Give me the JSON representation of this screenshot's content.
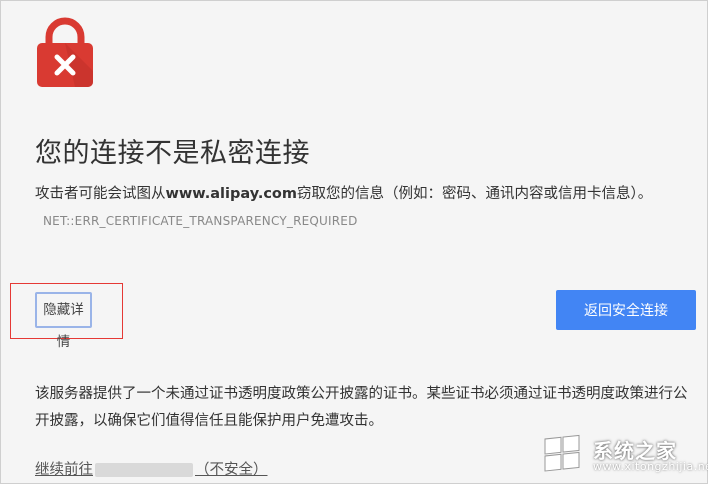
{
  "error": {
    "title": "您的连接不是私密连接",
    "description_prefix": "攻击者可能会试图从",
    "site": "www.alipay.com",
    "description_suffix": "窃取您的信息（例如：密码、通讯内容或信用卡信息）。",
    "error_code": "NET::ERR_CERTIFICATE_TRANSPARENCY_REQUIRED"
  },
  "buttons": {
    "details_label": "隐藏详情",
    "back_label": "返回安全连接"
  },
  "details": {
    "text": "该服务器提供了一个未通过证书透明度政策公开披露的证书。某些证书必须通过证书透明度政策进行公开披露，以确保它们值得信任且能保护用户免遭攻击。",
    "proceed_prefix": "继续前往",
    "proceed_suffix": "（不安全）"
  },
  "watermark": {
    "text": "系统之家",
    "url": "www.xitongzhijia.net"
  },
  "colors": {
    "lock_red": "#d93a32",
    "button_blue": "#4285f4",
    "highlight_red": "#e53935"
  }
}
